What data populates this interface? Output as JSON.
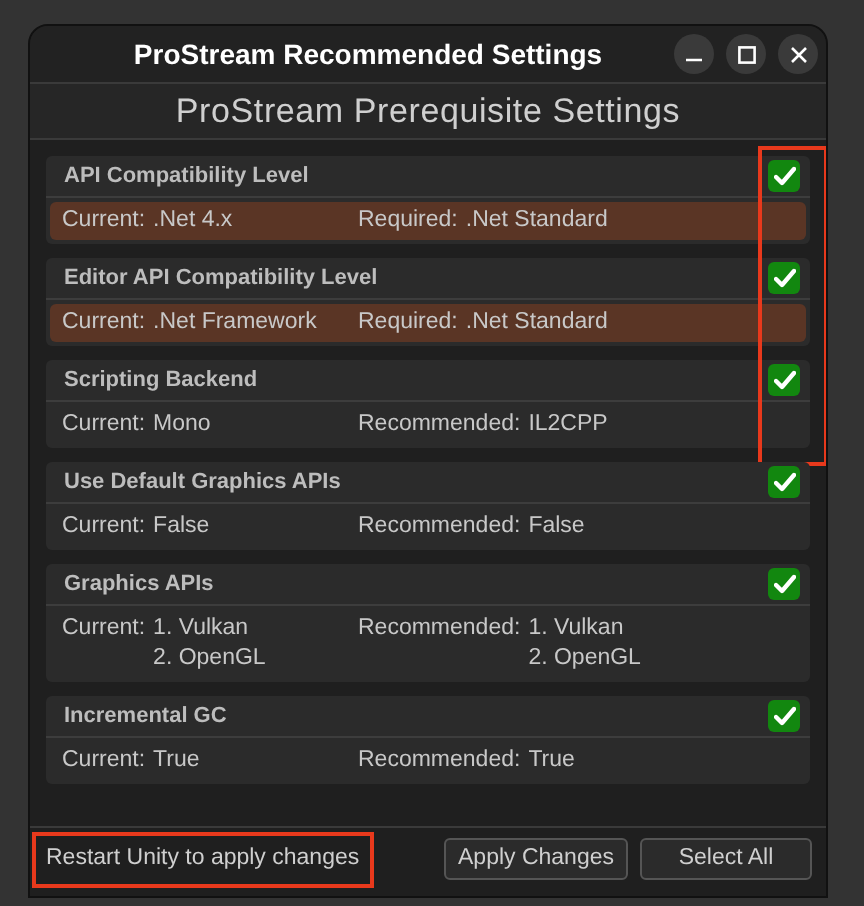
{
  "window": {
    "title": "ProStream Recommended Settings"
  },
  "header": "ProStream Prerequisite Settings",
  "settings": [
    {
      "title": "API Compatibility Level",
      "checked": true,
      "mismatch": true,
      "annotated": true,
      "current": {
        "label": "Current:",
        "values": [
          ".Net 4.x"
        ]
      },
      "target": {
        "label": "Required:",
        "values": [
          ".Net Standard"
        ]
      }
    },
    {
      "title": "Editor API Compatibility Level",
      "checked": true,
      "mismatch": true,
      "annotated": true,
      "current": {
        "label": "Current:",
        "values": [
          ".Net Framework"
        ]
      },
      "target": {
        "label": "Required:",
        "values": [
          ".Net Standard"
        ]
      }
    },
    {
      "title": "Scripting Backend",
      "checked": true,
      "mismatch": false,
      "annotated": true,
      "current": {
        "label": "Current:",
        "values": [
          "Mono"
        ]
      },
      "target": {
        "label": "Recommended:",
        "values": [
          "IL2CPP"
        ]
      }
    },
    {
      "title": "Use Default Graphics APIs",
      "checked": true,
      "mismatch": false,
      "annotated": false,
      "current": {
        "label": "Current:",
        "values": [
          "False"
        ]
      },
      "target": {
        "label": "Recommended:",
        "values": [
          "False"
        ]
      }
    },
    {
      "title": "Graphics APIs",
      "checked": true,
      "mismatch": false,
      "annotated": false,
      "current": {
        "label": "Current:",
        "values": [
          "1. Vulkan",
          "2. OpenGL"
        ]
      },
      "target": {
        "label": "Recommended:",
        "values": [
          "1. Vulkan",
          "2. OpenGL"
        ]
      }
    },
    {
      "title": "Incremental GC",
      "checked": true,
      "mismatch": false,
      "annotated": false,
      "current": {
        "label": "Current:",
        "values": [
          "True"
        ]
      },
      "target": {
        "label": "Recommended:",
        "values": [
          "True"
        ]
      }
    }
  ],
  "footer": {
    "note": {
      "text": "Restart Unity to apply changes",
      "annotated": true
    },
    "buttons": [
      "Apply Changes",
      "Select All"
    ]
  }
}
